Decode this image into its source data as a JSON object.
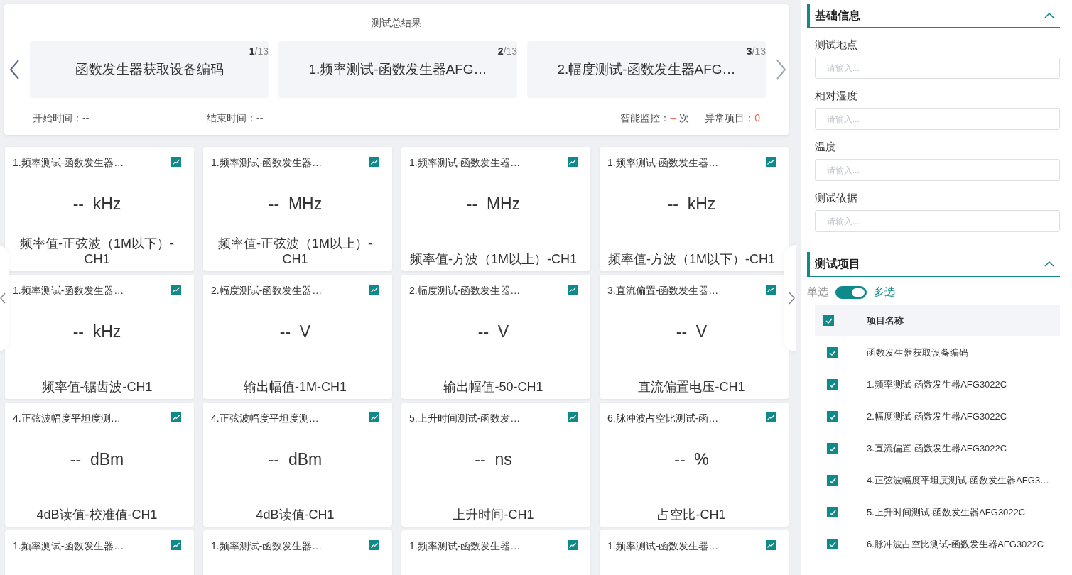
{
  "summary": {
    "title": "测试总结果",
    "items": [
      {
        "counter": "**1**/13",
        "text": "函数发生器获取设备编码"
      },
      {
        "counter": "**2**/13",
        "text": "1.频率测试-函数发生器AFG…"
      },
      {
        "counter": "**3**/13",
        "text": "2.幅度测试-函数发生器AFG…"
      }
    ],
    "start_label": "开始时间：",
    "start_value": "--",
    "end_label": "结束时间：",
    "end_value": "--",
    "monitor_label": "智能监控：",
    "monitor_value": "--",
    "monitor_unit": "次",
    "abnormal_label": "异常项目：",
    "abnormal_value": "0"
  },
  "cards": [
    {
      "title": "1.频率测试-函数发生器…",
      "value": "--",
      "unit": "kHz",
      "name": "频率值-正弦波（1M以下）-CH1"
    },
    {
      "title": "1.频率测试-函数发生器…",
      "value": "--",
      "unit": "MHz",
      "name": "频率值-正弦波（1M以上）-CH1"
    },
    {
      "title": "1.频率测试-函数发生器…",
      "value": "--",
      "unit": "MHz",
      "name": "频率值-方波（1M以上）-CH1"
    },
    {
      "title": "1.频率测试-函数发生器…",
      "value": "--",
      "unit": "kHz",
      "name": "频率值-方波（1M以下）-CH1"
    },
    {
      "title": "1.频率测试-函数发生器…",
      "value": "--",
      "unit": "kHz",
      "name": "频率值-锯齿波-CH1"
    },
    {
      "title": "2.幅度测试-函数发生器…",
      "value": "--",
      "unit": "V",
      "name": "输出幅值-1M-CH1"
    },
    {
      "title": "2.幅度测试-函数发生器…",
      "value": "--",
      "unit": "V",
      "name": "输出幅值-50-CH1"
    },
    {
      "title": "3.直流偏置-函数发生器…",
      "value": "--",
      "unit": "V",
      "name": "直流偏置电压-CH1"
    },
    {
      "title": "4.正弦波幅度平坦度测…",
      "value": "--",
      "unit": "dBm",
      "name": "4dB读值-校准值-CH1"
    },
    {
      "title": "4.正弦波幅度平坦度测…",
      "value": "--",
      "unit": "dBm",
      "name": "4dB读值-CH1"
    },
    {
      "title": "5.上升时间测试-函数发…",
      "value": "--",
      "unit": "ns",
      "name": "上升时间-CH1"
    },
    {
      "title": "6.脉冲波占空比测试-函…",
      "value": "--",
      "unit": "%",
      "name": "占空比-CH1"
    },
    {
      "title": "1.频率测试-函数发生器…"
    },
    {
      "title": "1.频率测试-函数发生器…"
    },
    {
      "title": "1.频率测试-函数发生器…"
    },
    {
      "title": "1.频率测试-函数发生器…"
    }
  ],
  "basic_info": {
    "title": "基础信息",
    "expanded": true,
    "fields": [
      {
        "label": "测试地点",
        "placeholder": "请输入..."
      },
      {
        "label": "相对湿度",
        "placeholder": "请输入..."
      },
      {
        "label": "温度",
        "placeholder": "请输入..."
      },
      {
        "label": "测试依据",
        "placeholder": "请输入..."
      }
    ]
  },
  "test_items": {
    "title": "测试项目",
    "expanded": true,
    "mode_single": "单选",
    "mode_multi": "多选",
    "multi_on": true,
    "header": {
      "label": "项目名称",
      "checked": true
    },
    "rows": [
      {
        "label": "函数发生器获取设备编码",
        "checked": true
      },
      {
        "label": "1.频率测试-函数发生器AFG3022C",
        "checked": true
      },
      {
        "label": "2.幅度测试-函数发生器AFG3022C",
        "checked": true
      },
      {
        "label": "3.直流偏置-函数发生器AFG3022C",
        "checked": true
      },
      {
        "label": "4.正弦波幅度平坦度测试-函数发生器AFG3…",
        "checked": true
      },
      {
        "label": "5.上升时间测试-函数发生器AFG3022C",
        "checked": true
      },
      {
        "label": "6.脉冲波占空比测试-函数发生器AFG3022C",
        "checked": true
      }
    ]
  }
}
